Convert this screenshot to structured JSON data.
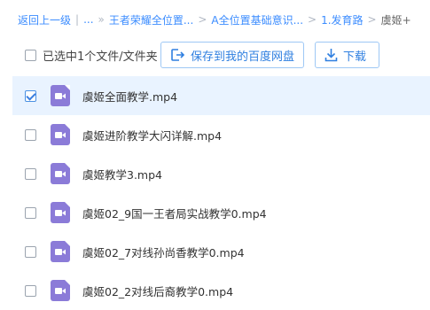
{
  "breadcrumb": {
    "items": [
      "返回上一级",
      "...",
      "王者荣耀全位置...",
      "A全位置基础意识...",
      "1.发育路"
    ],
    "current": "虞姬+"
  },
  "toolbar": {
    "selection_text": "已选中1个文件/文件夹",
    "save_label": "保存到我的百度网盘",
    "download_label": "下载"
  },
  "files": [
    {
      "name": "虞姬全面教学.mp4",
      "selected": true
    },
    {
      "name": "虞姬进阶教学大闪详解.mp4",
      "selected": false
    },
    {
      "name": "虞姬教学3.mp4",
      "selected": false
    },
    {
      "name": "虞姬02_9国一王者局实战教学0.mp4",
      "selected": false
    },
    {
      "name": "虞姬02_7对线孙尚香教学0.mp4",
      "selected": false
    },
    {
      "name": "虞姬02_2对线后裔教学0.mp4",
      "selected": false
    }
  ],
  "colors": {
    "accent": "#3b8cff",
    "selected_row": "#e9f3ff",
    "video_icon": "#8b7bd8"
  }
}
